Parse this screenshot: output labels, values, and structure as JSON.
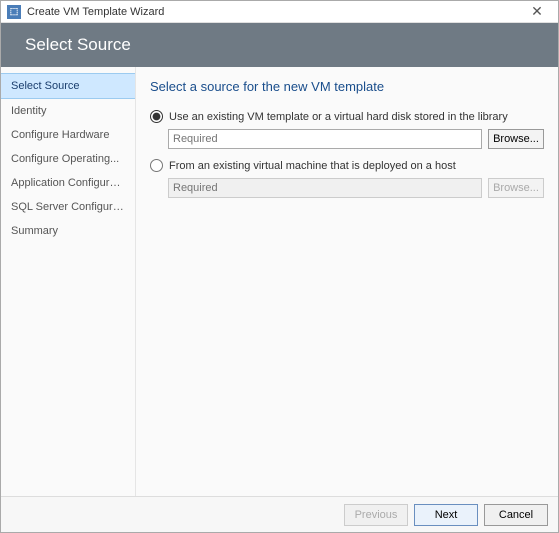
{
  "window": {
    "title": "Create VM Template Wizard",
    "close_glyph": "✕"
  },
  "banner": {
    "title": "Select Source"
  },
  "sidebar": {
    "items": [
      {
        "label": "Select Source",
        "selected": true
      },
      {
        "label": "Identity"
      },
      {
        "label": "Configure Hardware"
      },
      {
        "label": "Configure Operating..."
      },
      {
        "label": "Application Configuration"
      },
      {
        "label": "SQL Server Configuration"
      },
      {
        "label": "Summary"
      }
    ]
  },
  "main": {
    "heading": "Select a source for the new VM template",
    "option1": {
      "label": "Use an existing VM template or a virtual hard disk stored in the library",
      "placeholder": "Required",
      "browse_label": "Browse...",
      "checked": true
    },
    "option2": {
      "label": "From an existing virtual machine that is deployed on a host",
      "placeholder": "Required",
      "browse_label": "Browse...",
      "checked": false
    }
  },
  "footer": {
    "previous": "Previous",
    "next": "Next",
    "cancel": "Cancel"
  }
}
